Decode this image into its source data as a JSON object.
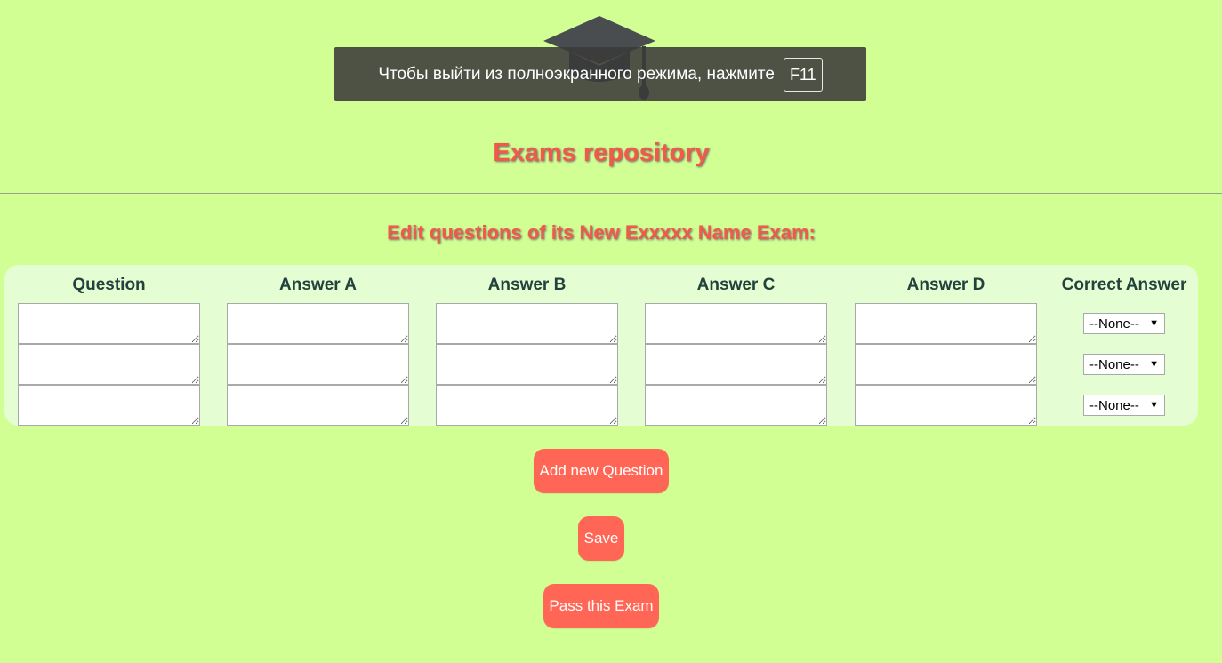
{
  "fullscreen_notice": {
    "message": "Чтобы выйти из полноэкранного режима, нажмите",
    "key": "F11"
  },
  "header": {
    "title": "Exams repository",
    "subtitle": "Edit questions of its New Exxxxx Name Exam:"
  },
  "table": {
    "columns": [
      "Question",
      "Answer A",
      "Answer B",
      "Answer C",
      "Answer D",
      "Correct Answer"
    ],
    "rows": [
      {
        "question": "",
        "answer_a": "",
        "answer_b": "",
        "answer_c": "",
        "answer_d": "",
        "correct": "--None--"
      },
      {
        "question": "",
        "answer_a": "",
        "answer_b": "",
        "answer_c": "",
        "answer_d": "",
        "correct": "--None--"
      },
      {
        "question": "",
        "answer_a": "",
        "answer_b": "",
        "answer_c": "",
        "answer_d": "",
        "correct": "--None--"
      }
    ]
  },
  "buttons": {
    "add_question": "Add new Question",
    "save": "Save",
    "pass_exam": "Pass this Exam"
  },
  "icons": {
    "logo": "graduation-cap-icon",
    "dropdown": "caret-down-icon"
  },
  "colors": {
    "background": "#d1ff93",
    "panel": "#e5fdd2",
    "accent": "#ff6655",
    "heading": "#f05a48",
    "column_header": "#24423d"
  }
}
